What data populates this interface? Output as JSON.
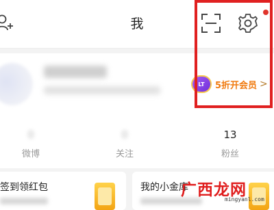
{
  "header": {
    "title": "我"
  },
  "vip": {
    "badge": "LT",
    "label": "5折开会员",
    "arrow": ">"
  },
  "stats": [
    {
      "value": "",
      "label": "微博"
    },
    {
      "value": "",
      "label": "关注"
    },
    {
      "value": "13",
      "label": "粉丝"
    }
  ],
  "cards": {
    "left_title": "签到领红包",
    "right_title": "我的小金库"
  },
  "watermark": {
    "text": "广西龙网",
    "url": "mingyanl.com"
  },
  "colors": {
    "highlight": "#e02020",
    "vip_text": "#f07a0f",
    "notification_dot": "#e0342b"
  }
}
